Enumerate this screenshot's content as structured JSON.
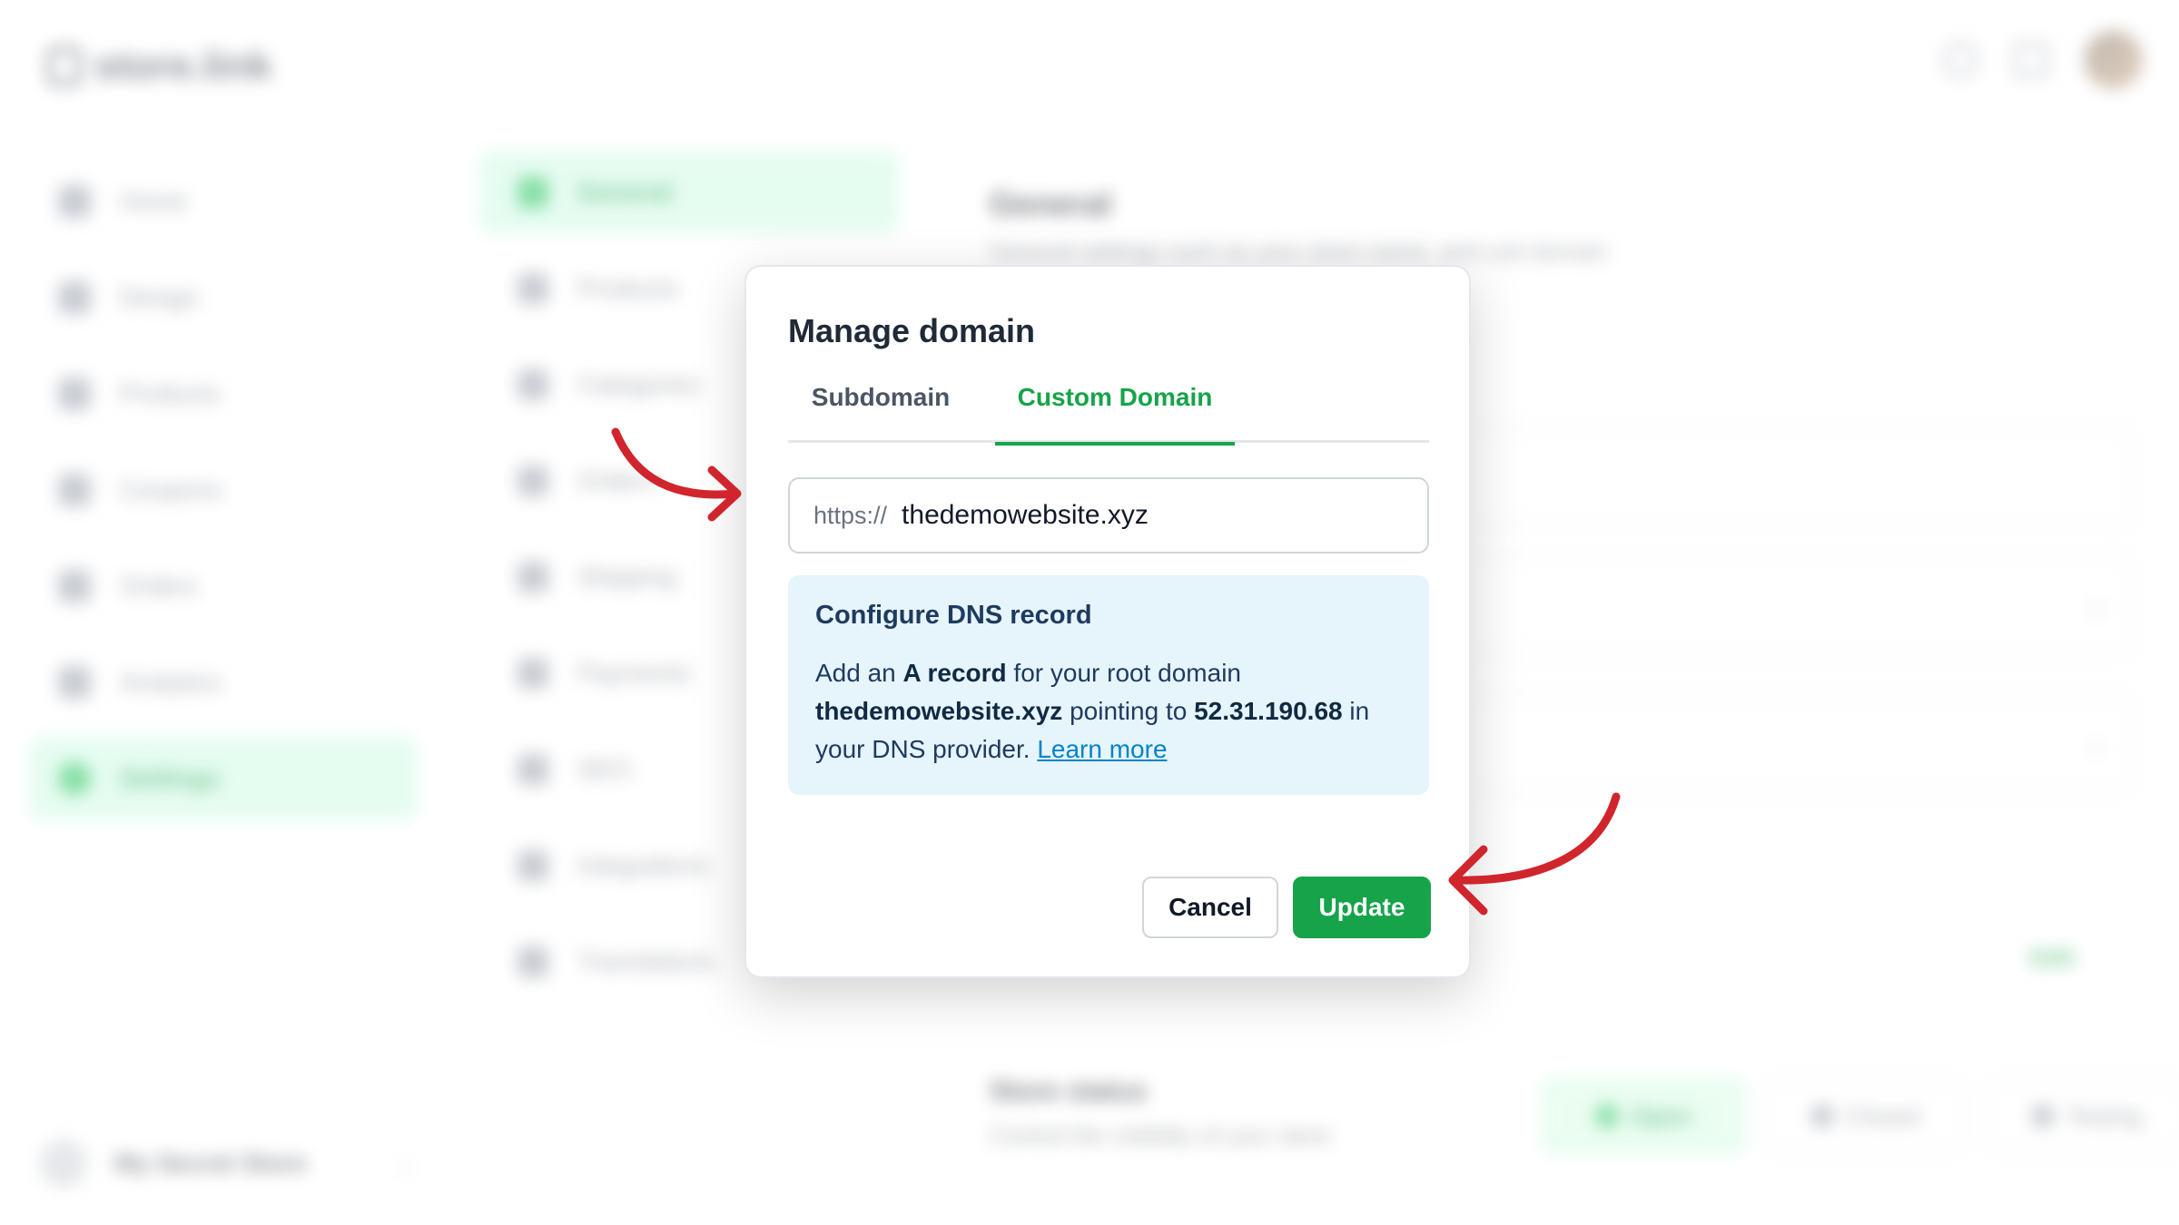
{
  "background": {
    "logo_text": "store.link",
    "side_nav": [
      "Home",
      "Design",
      "Products",
      "Coupons",
      "Orders",
      "Analytics",
      "Settings"
    ],
    "side_nav_active": "Settings",
    "store_name": "My Secret Store",
    "settings_nav": [
      "General",
      "Products",
      "Categories",
      "Orders",
      "Shipping",
      "Payments",
      "SEO",
      "Integrations",
      "Translations"
    ],
    "settings_nav_active": "General",
    "main_title": "General",
    "main_subtitle": "General settings such as your store name, and sub domain",
    "edit_label": "Edit",
    "store_status_title": "Store status",
    "store_status_subtitle": "Control the visibility of your store",
    "status_options": [
      "Open",
      "Closed",
      "Testing"
    ]
  },
  "modal": {
    "title": "Manage domain",
    "tabs": [
      "Subdomain",
      "Custom Domain"
    ],
    "active_tab": "Custom Domain",
    "input_prefix": "https://",
    "input_value": "thedemowebsite.xyz",
    "dns": {
      "title": "Configure DNS record",
      "text_1": "Add an ",
      "record_type": "A record",
      "text_2": " for your root domain ",
      "domain": "thedemowebsite.xyz",
      "text_3": " pointing to ",
      "ip": "52.31.190.68",
      "text_4": " in your DNS provider. ",
      "learn_more": "Learn more"
    },
    "cancel_label": "Cancel",
    "update_label": "Update"
  },
  "colors": {
    "accent": "#16a34a",
    "info_bg": "#e6f4fb",
    "link": "#0284c7",
    "arrow": "#d0252c"
  }
}
